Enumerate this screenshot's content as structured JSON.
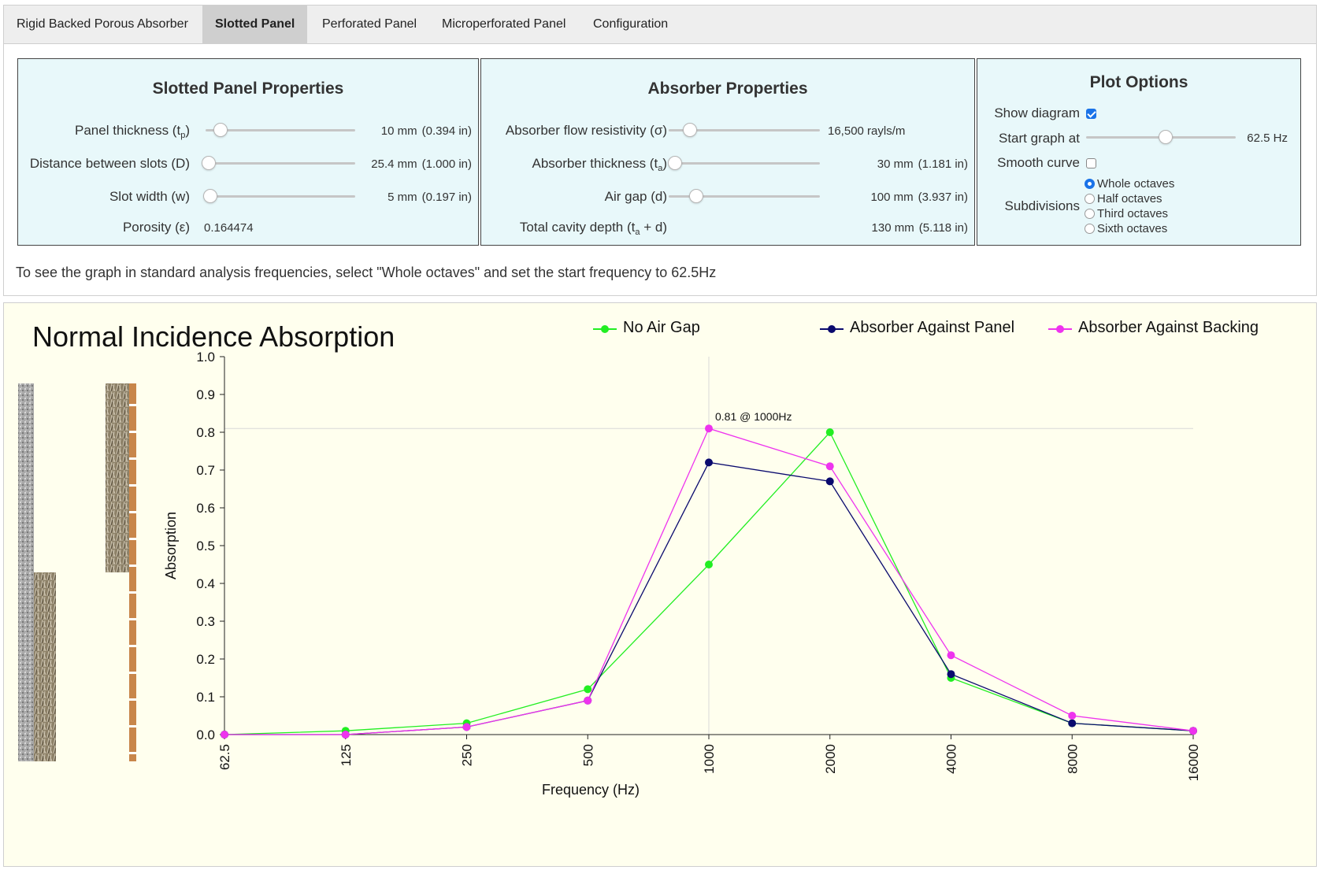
{
  "tabs": [
    {
      "label": "Rigid Backed Porous Absorber",
      "active": false
    },
    {
      "label": "Slotted Panel",
      "active": true
    },
    {
      "label": "Perforated Panel",
      "active": false
    },
    {
      "label": "Microperforated Panel",
      "active": false
    },
    {
      "label": "Configuration",
      "active": false
    }
  ],
  "slotted_panel": {
    "title": "Slotted Panel Properties",
    "panel_thickness": {
      "label": "Panel thickness (t",
      "sub": "p",
      "label_end": ")",
      "value": "10 mm",
      "value_in": "(0.394 in)",
      "level": 0.1
    },
    "slot_distance": {
      "label": "Distance between slots (D)",
      "value": "25.4 mm",
      "value_in": "(1.000 in)",
      "level": 0.02
    },
    "slot_width": {
      "label": "Slot width (w)",
      "value": "5 mm",
      "value_in": "(0.197 in)",
      "level": 0.03
    },
    "porosity": {
      "label": "Porosity (ε)",
      "value": "0.164474"
    }
  },
  "absorber": {
    "title": "Absorber Properties",
    "flow_resistivity": {
      "label": "Absorber flow resistivity (σ)",
      "value": "16,500 rayls/m",
      "level": 0.14
    },
    "thickness": {
      "label": "Absorber thickness (t",
      "sub": "a",
      "label_end": ")",
      "value": "30 mm",
      "value_in": "(1.181 in)",
      "level": 0.04
    },
    "air_gap": {
      "label": "Air gap (d)",
      "value": "100 mm",
      "value_in": "(3.937 in)",
      "level": 0.18
    },
    "cavity": {
      "label": "Total cavity depth (t",
      "sub": "a",
      "label_end": " + d)",
      "value": "130 mm",
      "value_in": "(5.118 in)"
    }
  },
  "plot_options": {
    "title": "Plot Options",
    "show_diagram": {
      "label": "Show diagram",
      "checked": true
    },
    "start_graph": {
      "label": "Start graph at",
      "value": "62.5 Hz",
      "level": 0.53
    },
    "smooth_curve": {
      "label": "Smooth curve",
      "checked": false
    },
    "subdivisions": {
      "label": "Subdivisions",
      "options": [
        "Whole octaves",
        "Half octaves",
        "Third octaves",
        "Sixth octaves"
      ],
      "selected": "Whole octaves"
    }
  },
  "hint": "To see the graph in standard analysis frequencies, select \"Whole octaves\" and set the start frequency to 62.5Hz",
  "colors": {
    "no_air_gap": "#22ee22",
    "against_panel": "#0a0a6e",
    "against_backing": "#ee33ee"
  },
  "chart_data": {
    "type": "line",
    "title": "Normal Incidence Absorption",
    "xlabel": "Frequency (Hz)",
    "ylabel": "Absorption",
    "categories": [
      "62.5",
      "125",
      "250",
      "500",
      "1000",
      "2000",
      "4000",
      "8000",
      "16000"
    ],
    "yticks": [
      "0.0",
      "0.1",
      "0.2",
      "0.3",
      "0.4",
      "0.5",
      "0.6",
      "0.7",
      "0.8",
      "0.9",
      "1.0"
    ],
    "ylim": [
      0,
      1
    ],
    "legend_position": "top",
    "series": [
      {
        "name": "No Air Gap",
        "values": [
          0.0,
          0.01,
          0.03,
          0.12,
          0.45,
          0.8,
          0.15,
          0.03,
          0.01
        ]
      },
      {
        "name": "Absorber Against Panel",
        "values": [
          0.0,
          0.0,
          0.02,
          0.09,
          0.72,
          0.67,
          0.16,
          0.03,
          0.01
        ]
      },
      {
        "name": "Absorber Against Backing",
        "values": [
          0.0,
          0.0,
          0.02,
          0.09,
          0.81,
          0.71,
          0.21,
          0.05,
          0.01
        ]
      }
    ],
    "annotation": {
      "text": "0.81 @ 1000Hz",
      "category": "1000",
      "value": 0.81
    }
  }
}
